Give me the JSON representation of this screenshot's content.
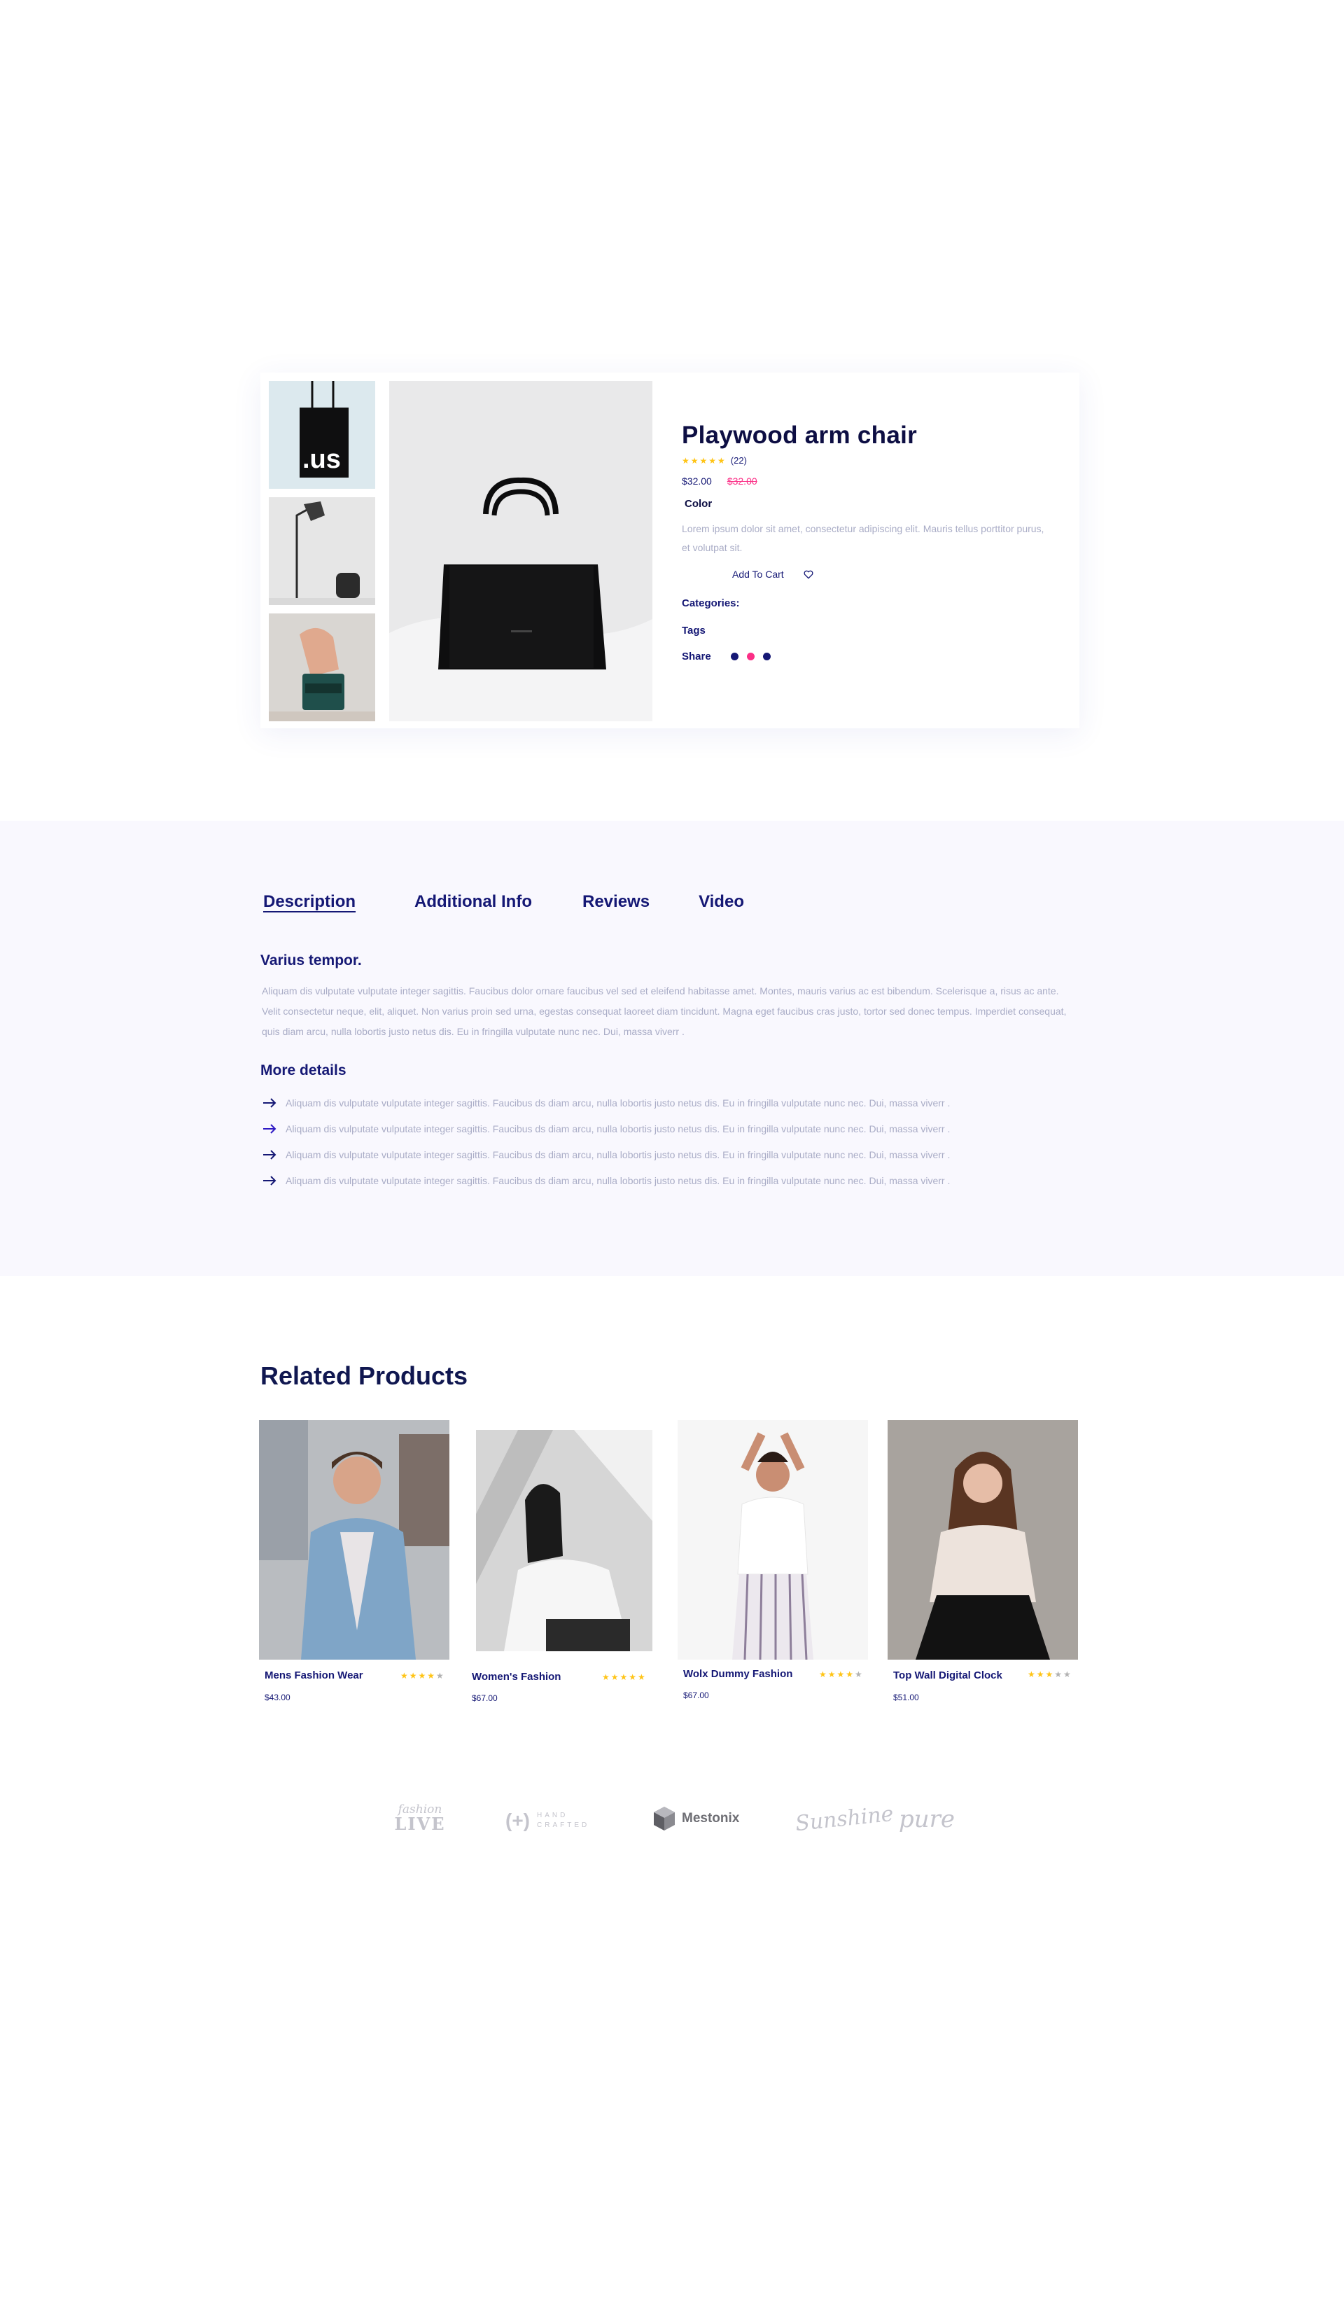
{
  "product": {
    "title": "Playwood arm chair",
    "rating_count": "(22)",
    "price": "$32.00",
    "old_price": "$32.00",
    "color_label": "Color",
    "description": "Lorem ipsum dolor sit amet, consectetur adipiscing elit. Mauris tellus porttitor purus, et volutpat sit.",
    "add_to_cart": "Add To Cart",
    "categories_label": "Categories:",
    "tags_label": "Tags",
    "share_label": "Share",
    "thumbnails": [
      {
        "text": ".us"
      }
    ],
    "social_colors": [
      "#151875",
      "#fb2e86",
      "#151875"
    ]
  },
  "tabs": {
    "items": [
      "Description",
      "Additional Info",
      "Reviews",
      "Video"
    ],
    "active": "Description",
    "section_title": "Varius tempor.",
    "paragraph": "Aliquam dis vulputate vulputate integer sagittis. Faucibus dolor ornare faucibus vel sed et eleifend habitasse amet. Montes, mauris varius ac est bibendum. Scelerisque a, risus ac ante. Velit consectetur neque, elit, aliquet. Non varius proin sed urna, egestas consequat laoreet diam tincidunt. Magna eget faucibus cras justo, tortor sed donec tempus. Imperdiet consequat, quis diam arcu, nulla lobortis justo netus dis. Eu in fringilla vulputate nunc nec. Dui, massa viverr .",
    "more_title": "More details",
    "details": [
      "Aliquam dis vulputate vulputate integer sagittis. Faucibus ds diam arcu, nulla lobortis justo netus dis. Eu in fringilla vulputate nunc nec. Dui, massa viverr .",
      "Aliquam dis vulputate vulputate integer sagittis. Faucibus ds diam arcu, nulla lobortis justo netus dis. Eu in fringilla vulputate nunc nec. Dui, massa viverr .",
      "Aliquam dis vulputate vulputate integer sagittis. Faucibus ds diam arcu, nulla lobortis justo netus dis. Eu in fringilla vulputate nunc nec. Dui, massa viverr .",
      "Aliquam dis vulputate vulputate integer sagittis. Faucibus ds diam arcu, nulla lobortis justo netus dis. Eu in fringilla vulputate nunc nec. Dui, massa viverr ."
    ]
  },
  "related": {
    "title": "Related Products",
    "products": [
      {
        "name": "Mens Fashion Wear",
        "price": "$43.00",
        "rating": 4
      },
      {
        "name": "Women's Fashion",
        "price": "$67.00",
        "rating": 5
      },
      {
        "name": "Wolx Dummy Fashion",
        "price": "$67.00",
        "rating": 4
      },
      {
        "name": "Top Wall Digital Clock",
        "price": "$51.00",
        "rating": 3
      }
    ]
  },
  "brands": {
    "fashion_live": {
      "small": "fashion",
      "big": "LIVE"
    },
    "handcrafted": {
      "mark": "(+)",
      "line1": "HAND",
      "line2": "CRAFTED"
    },
    "mestonix": "Mestonix",
    "sunshine": "Sunshine",
    "pure": "pure"
  },
  "colors": {
    "primary": "#151875",
    "accent_pink": "#fb2e86",
    "star": "#ffc416",
    "muted_text": "#a9acc6",
    "section_bg": "#f9f8fe"
  }
}
